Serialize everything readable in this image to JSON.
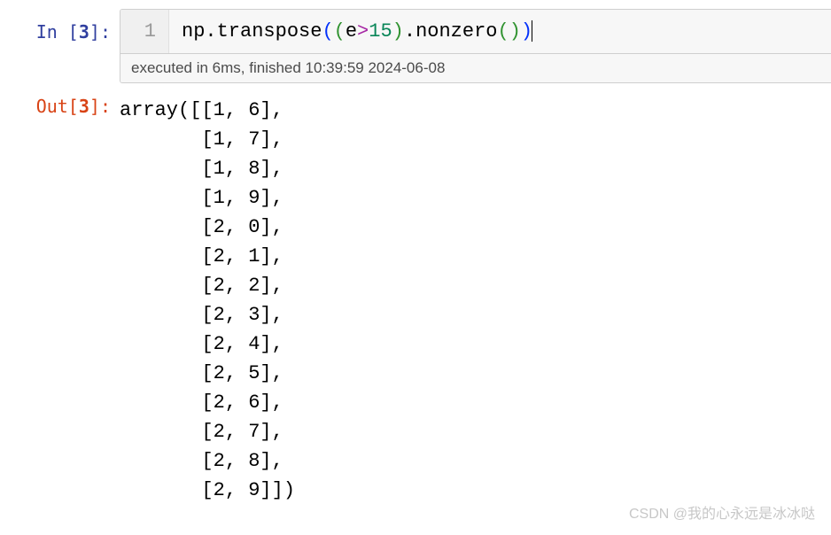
{
  "cell": {
    "in_prompt_prefix": "In [",
    "in_prompt_number": "3",
    "in_prompt_suffix": "]:",
    "out_prompt_prefix": "Out[",
    "out_prompt_number": "3",
    "out_prompt_suffix": "]:",
    "gutter_line": "1",
    "code_tokens": {
      "np": "np",
      "dot1": ".",
      "transpose": "transpose",
      "lp1": "(",
      "lp2": "(",
      "e": "e",
      "gt": ">",
      "num15": "15",
      "rp2": ")",
      "dot2": ".",
      "nonzero": "nonzero",
      "lp3": "(",
      "rp3": ")",
      "rp1": ")"
    },
    "exec_info": "executed in 6ms, finished 10:39:59 2024-06-08",
    "output_text": "array([[1, 6],\n       [1, 7],\n       [1, 8],\n       [1, 9],\n       [2, 0],\n       [2, 1],\n       [2, 2],\n       [2, 3],\n       [2, 4],\n       [2, 5],\n       [2, 6],\n       [2, 7],\n       [2, 8],\n       [2, 9]])"
  },
  "watermark": "CSDN @我的心永远是冰冰哒"
}
